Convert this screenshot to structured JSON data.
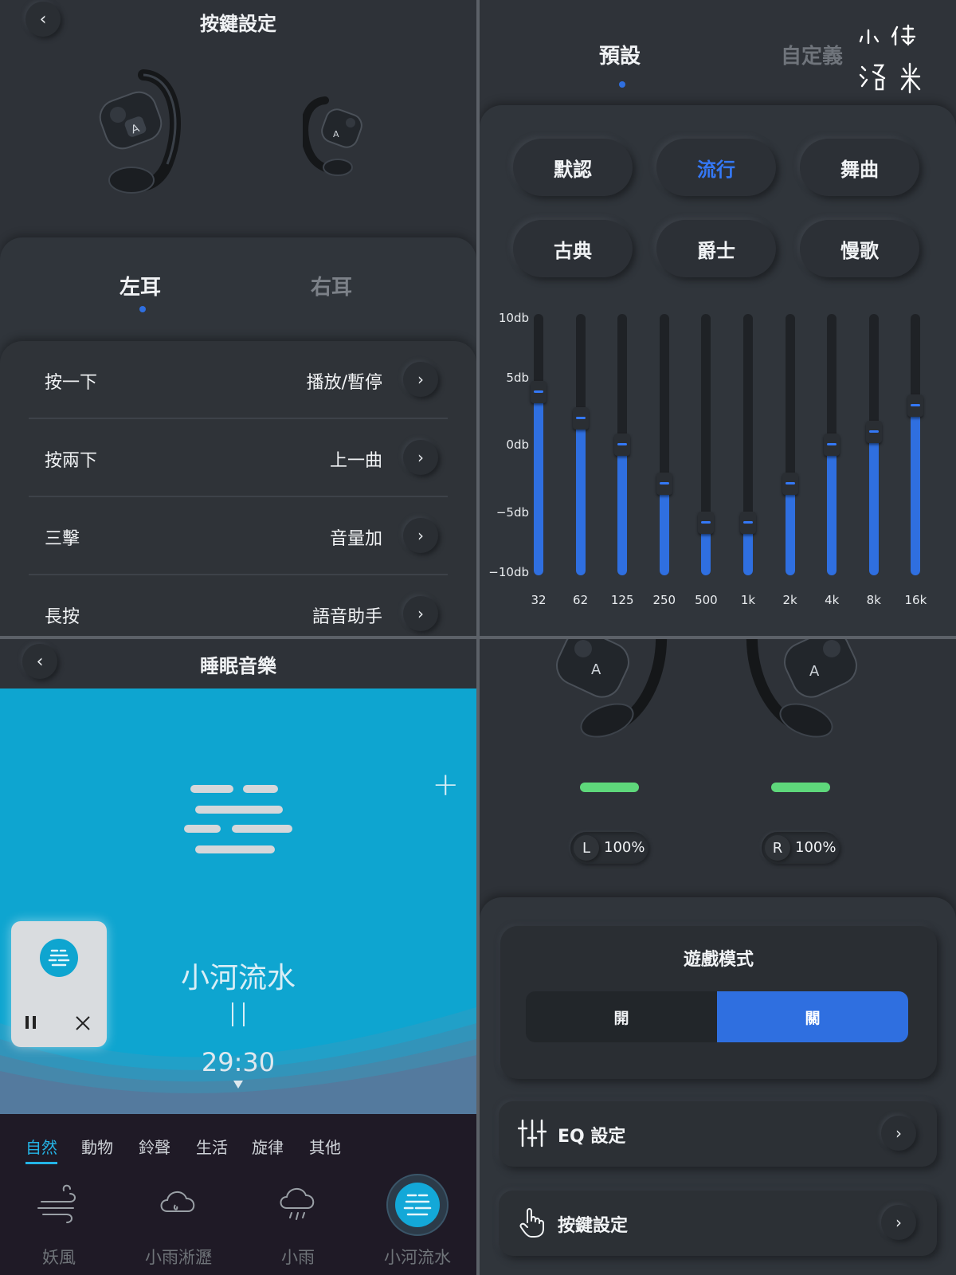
{
  "key_settings": {
    "title": "按鍵設定",
    "tabs": [
      {
        "label": "左耳",
        "active": true
      },
      {
        "label": "右耳",
        "active": false
      }
    ],
    "rows": [
      {
        "label": "按一下",
        "value": "播放/暫停"
      },
      {
        "label": "按兩下",
        "value": "上一曲"
      },
      {
        "label": "三擊",
        "value": "音量加"
      },
      {
        "label": "長按",
        "value": "語音助手"
      }
    ]
  },
  "equalizer": {
    "tabs": [
      {
        "label": "預設",
        "active": true
      },
      {
        "label": "自定義",
        "active": false
      }
    ],
    "presets": [
      {
        "label": "默認",
        "active": false
      },
      {
        "label": "流行",
        "active": true
      },
      {
        "label": "舞曲",
        "active": false
      },
      {
        "label": "古典",
        "active": false
      },
      {
        "label": "爵士",
        "active": false
      },
      {
        "label": "慢歌",
        "active": false
      }
    ],
    "db_labels": [
      "10db",
      "5db",
      "0db",
      "−5db",
      "−10db"
    ],
    "bands": [
      {
        "freq": "32",
        "db": 4
      },
      {
        "freq": "62",
        "db": 2
      },
      {
        "freq": "125",
        "db": 0
      },
      {
        "freq": "250",
        "db": -3
      },
      {
        "freq": "500",
        "db": -6
      },
      {
        "freq": "1k",
        "db": -6
      },
      {
        "freq": "2k",
        "db": -3
      },
      {
        "freq": "4k",
        "db": 0
      },
      {
        "freq": "8k",
        "db": 1
      },
      {
        "freq": "16k",
        "db": 3
      }
    ],
    "db_range": [
      -10,
      10
    ],
    "accent_color": "#2f6fe0",
    "signature_text": "小傑洛米"
  },
  "sleep_music": {
    "title": "睡眠音樂",
    "track": "小河流水",
    "timer": "29:30",
    "categories": [
      {
        "label": "自然",
        "active": true
      },
      {
        "label": "動物",
        "active": false
      },
      {
        "label": "鈴聲",
        "active": false
      },
      {
        "label": "生活",
        "active": false
      },
      {
        "label": "旋律",
        "active": false
      },
      {
        "label": "其他",
        "active": false
      }
    ],
    "sounds": [
      {
        "label": "妖風",
        "icon": "wind-icon",
        "active": false
      },
      {
        "label": "小雨淅瀝",
        "icon": "drizzle-cloud-icon",
        "active": false
      },
      {
        "label": "小雨",
        "icon": "rain-cloud-icon",
        "active": false
      },
      {
        "label": "小河流水",
        "icon": "stream-icon",
        "active": true
      }
    ],
    "stage_color": "#0ea5d0"
  },
  "device": {
    "left": {
      "side": "L",
      "battery": "100%",
      "level": 1.0
    },
    "right": {
      "side": "R",
      "battery": "100%",
      "level": 1.0
    },
    "game_mode": {
      "title": "遊戲模式",
      "on_label": "開",
      "off_label": "關",
      "selected": "關"
    },
    "settings": [
      {
        "label": "EQ 設定",
        "icon": "sliders-icon"
      },
      {
        "label": "按鍵設定",
        "icon": "hand-pointer-icon"
      }
    ],
    "battery_color": "#5ed87b"
  }
}
